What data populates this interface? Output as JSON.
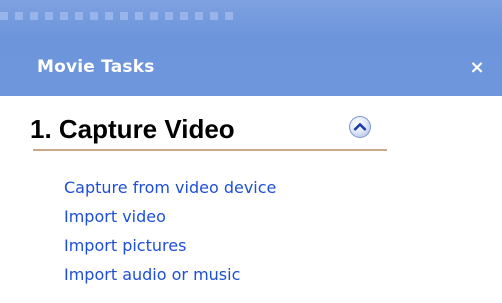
{
  "pane": {
    "title": "Movie Tasks",
    "close_glyph": "×",
    "close_icon": "close-icon"
  },
  "section": {
    "title": "1. Capture Video",
    "collapse_icon": "chevron-up-circle-icon",
    "links": [
      "Capture from video device",
      "Import video",
      "Import pictures",
      "Import audio or music"
    ]
  },
  "colors": {
    "header_bg": "#6e96dc",
    "link": "#1e4fd8",
    "rule": "#c9a889"
  }
}
